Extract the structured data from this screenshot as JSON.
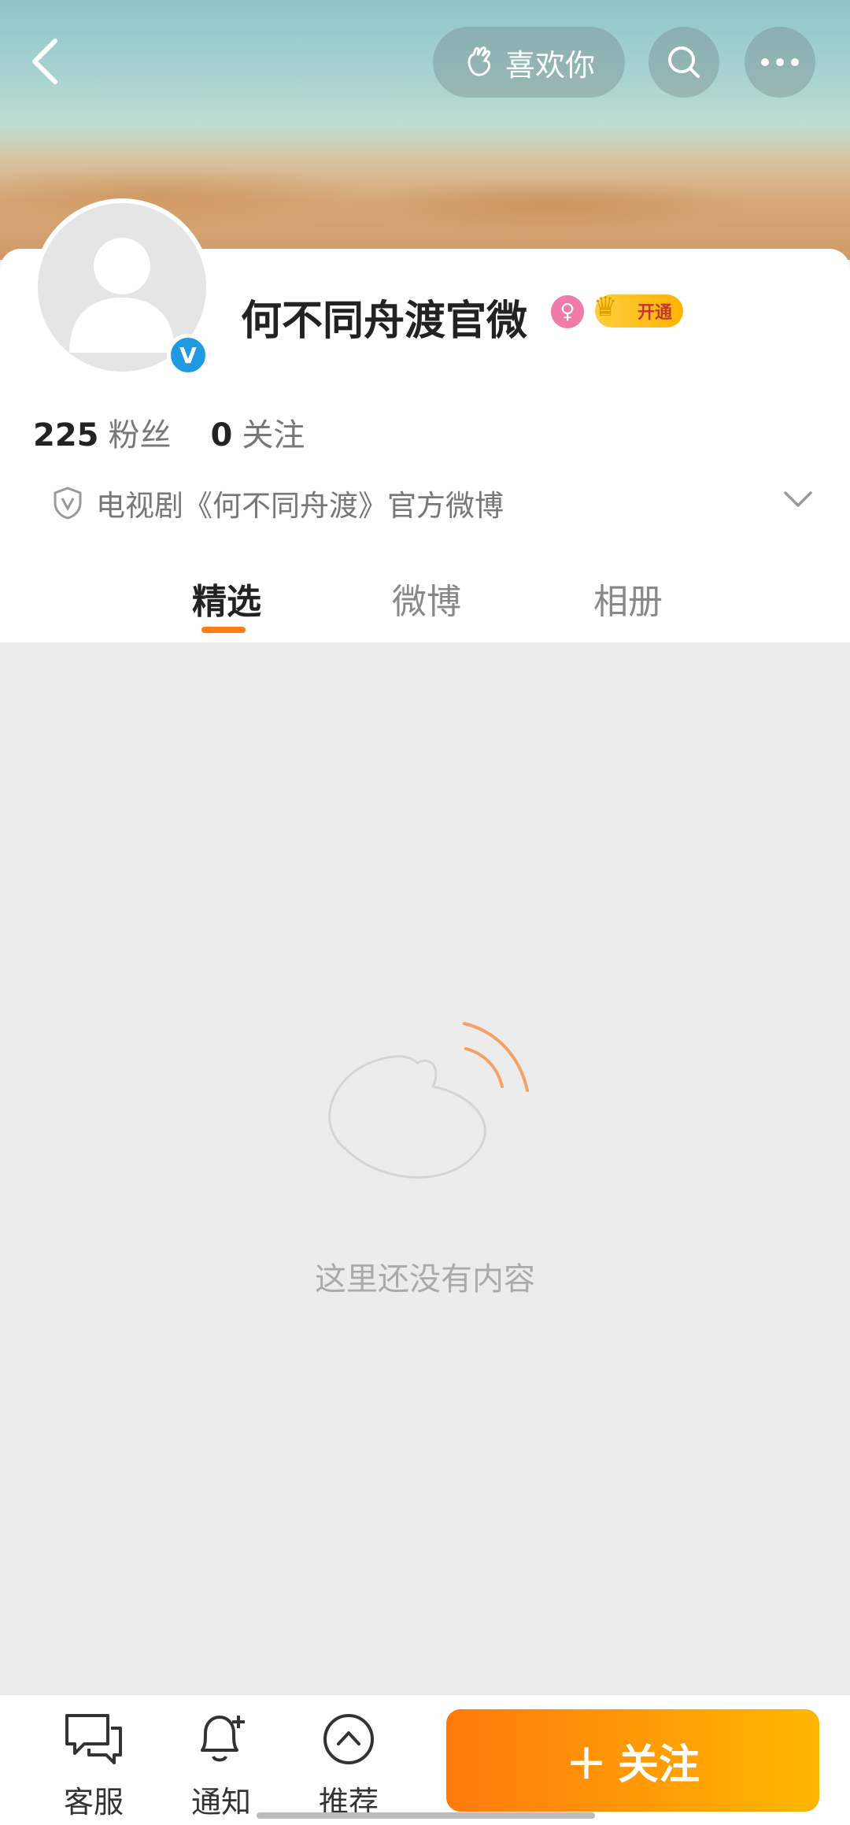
{
  "header": {
    "like_label": "喜欢你"
  },
  "profile": {
    "name": "何不同舟渡官微",
    "vip_label": "开通",
    "fans_count": "225",
    "fans_label": "粉丝",
    "following_count": "0",
    "following_label": "关注",
    "bio": "电视剧《何不同舟渡》官方微博"
  },
  "tabs": [
    {
      "label": "精选",
      "active": true
    },
    {
      "label": "微博",
      "active": false
    },
    {
      "label": "相册",
      "active": false
    }
  ],
  "empty_state": {
    "text": "这里还没有内容"
  },
  "bottom_bar": {
    "service_label": "客服",
    "notify_label": "通知",
    "recommend_label": "推荐",
    "follow_label": "关注"
  },
  "colors": {
    "accent": "#ff7d17",
    "verified_blue": "#1f9ae0"
  }
}
